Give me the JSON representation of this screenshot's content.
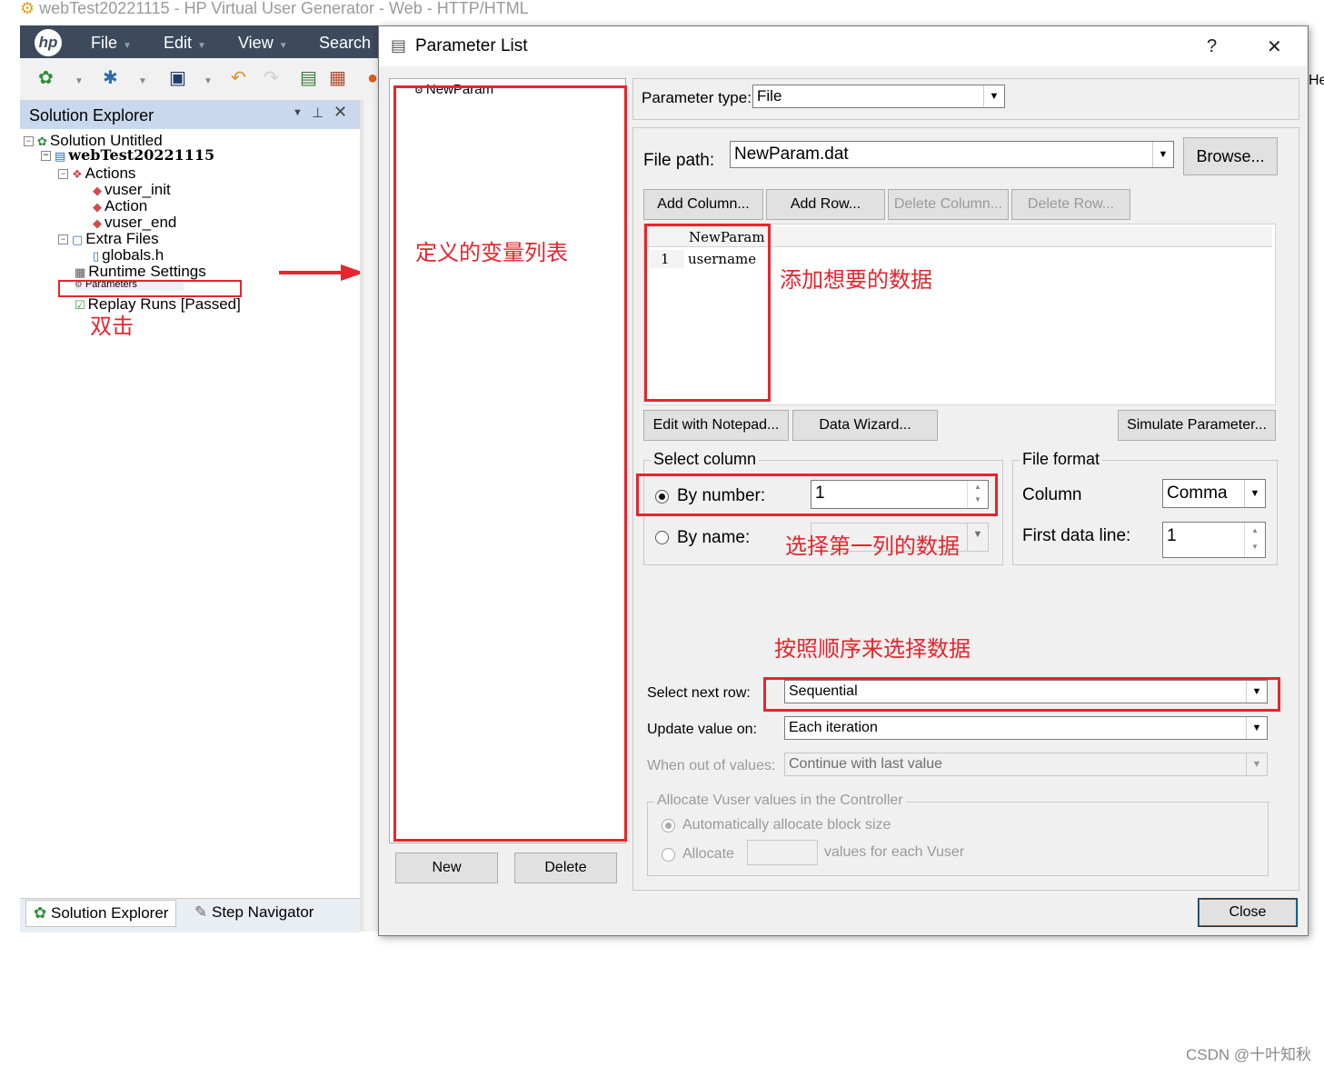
{
  "app": {
    "window_title": "webTest20221115 - HP Virtual User Generator - Web - HTTP/HTML",
    "menu": [
      "File",
      "Edit",
      "View",
      "Search"
    ],
    "right_edge_text": "He",
    "logo_text": "hp"
  },
  "solution_explorer": {
    "title": "Solution Explorer",
    "tree": {
      "solution": "Solution Untitled",
      "script": "webTest20221115",
      "actions_folder": "Actions",
      "actions": [
        "vuser_init",
        "Action",
        "vuser_end"
      ],
      "extra_files_folder": "Extra Files",
      "extra_files": [
        "globals.h"
      ],
      "runtime_settings": "Runtime Settings",
      "parameters": "Parameters",
      "replay_runs": "Replay Runs [Passed]"
    },
    "bottom_tabs": [
      "Solution Explorer",
      "Step Navigator"
    ]
  },
  "annotations": {
    "double_click": "双击",
    "variable_list": "定义的变量列表",
    "add_data": "添加想要的数据",
    "select_first_column": "选择第一列的数据",
    "select_in_order": "按照顺序来选择数据"
  },
  "dialog": {
    "title": "Parameter List",
    "help": "?",
    "close_x": "✕",
    "param_list": [
      "NewParam"
    ],
    "new_button": "New",
    "delete_button": "Delete",
    "parameter_type_label": "Parameter type:",
    "parameter_type_value": "File",
    "file_path_label": "File path:",
    "file_path_value": "NewParam.dat",
    "browse_button": "Browse...",
    "add_column": "Add Column...",
    "add_row": "Add Row...",
    "delete_column": "Delete Column...",
    "delete_row": "Delete Row...",
    "grid": {
      "columns": [
        "NewParam"
      ],
      "rows": [
        {
          "index": "1",
          "values": [
            "username"
          ]
        }
      ]
    },
    "edit_notepad": "Edit with Notepad...",
    "data_wizard": "Data Wizard...",
    "simulate": "Simulate Parameter...",
    "select_column": {
      "title": "Select column",
      "by_number_label": "By number:",
      "by_number_value": "1",
      "by_name_label": "By name:"
    },
    "file_format": {
      "title": "File format",
      "column_label": "Column",
      "column_value": "Comma",
      "first_line_label": "First data line:",
      "first_line_value": "1"
    },
    "select_next_row_label": "Select next row:",
    "select_next_row_value": "Sequential",
    "update_value_label": "Update value on:",
    "update_value_value": "Each iteration",
    "out_of_values_label": "When out of values:",
    "out_of_values_value": "Continue with last value",
    "allocate_group": {
      "title": "Allocate Vuser values in the Controller",
      "auto_label": "Automatically allocate block size",
      "allocate_label": "Allocate",
      "values_suffix": "values for each Vuser"
    },
    "close_button": "Close"
  },
  "watermark": "CSDN @十叶知秋"
}
